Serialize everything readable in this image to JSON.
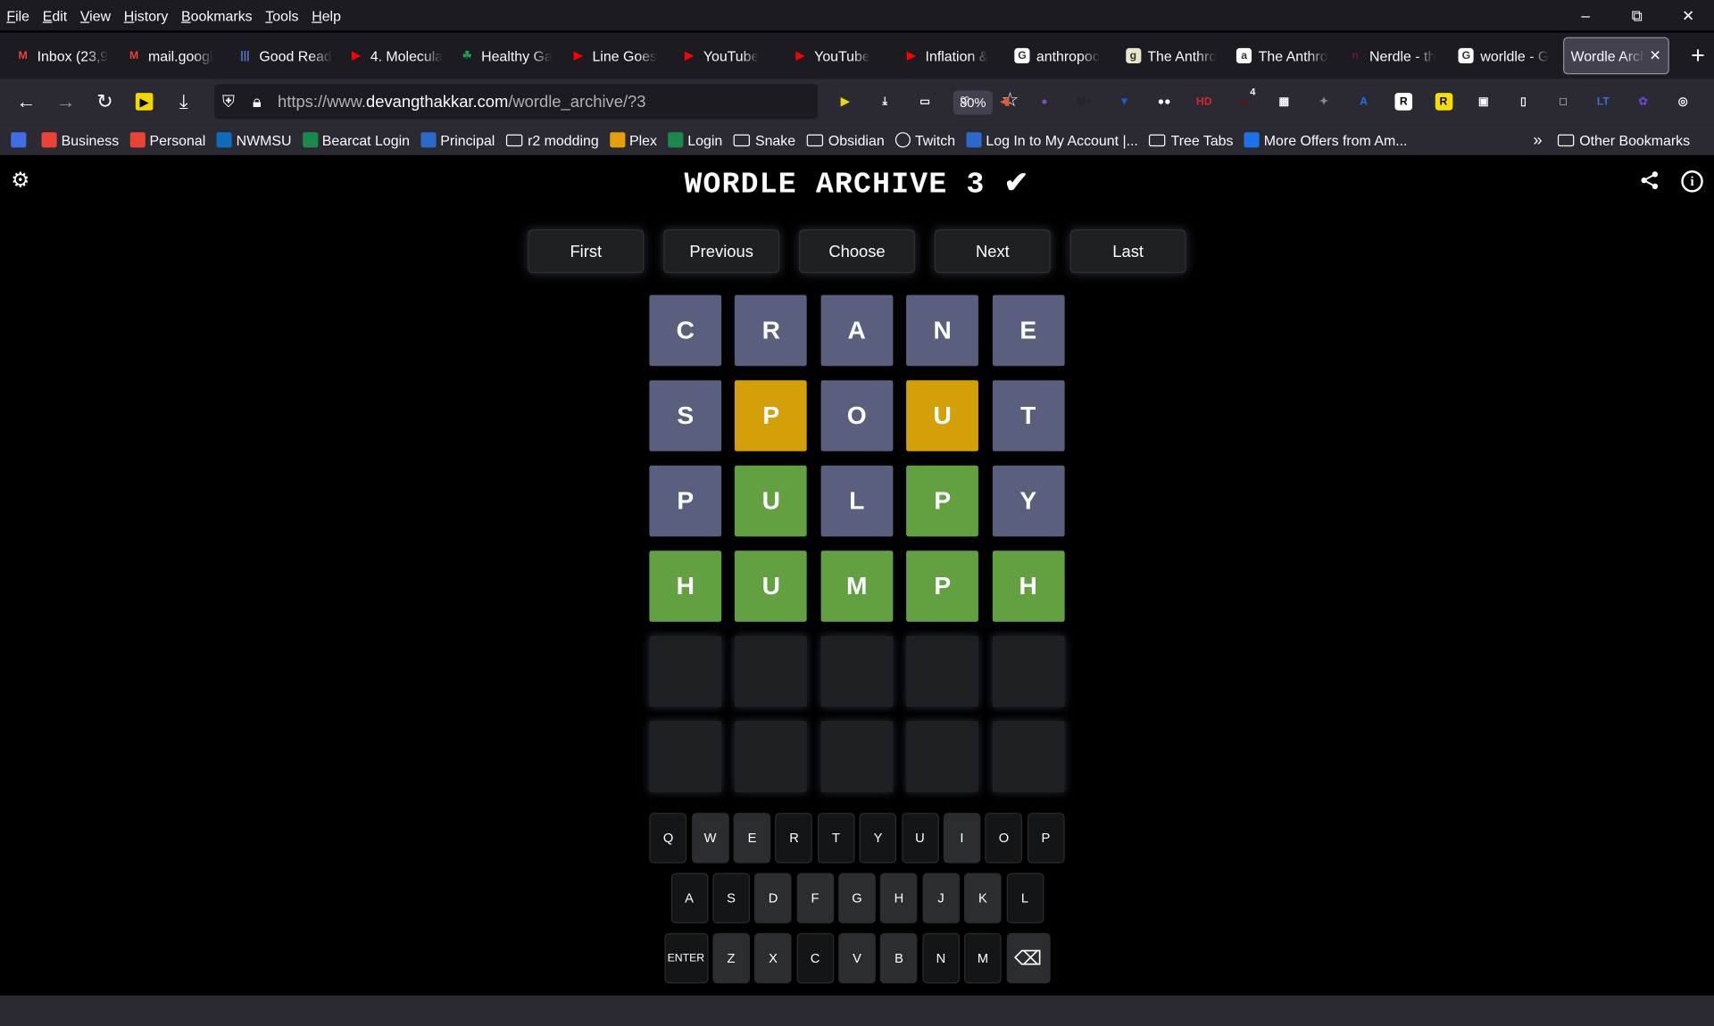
{
  "menu": [
    "File",
    "Edit",
    "View",
    "History",
    "Bookmarks",
    "Tools",
    "Help"
  ],
  "window_controls": {
    "minimize": "–",
    "restore": "⧉",
    "close": "✕"
  },
  "tabs": [
    {
      "label": "Inbox (23,9",
      "icon": "gmail-icon",
      "color": "#ea4335",
      "glyph": "M"
    },
    {
      "label": "mail.googl",
      "icon": "gmail-icon",
      "color": "#ea4335",
      "glyph": "M"
    },
    {
      "label": "Good Read",
      "icon": "library-icon",
      "color": "#4f7bd9",
      "glyph": "|||"
    },
    {
      "label": "4. Molecula",
      "icon": "youtube-icon",
      "color": "#ff0000",
      "glyph": "▶"
    },
    {
      "label": "Healthy Ga",
      "icon": "clover-icon",
      "color": "#1aa34a",
      "glyph": "☘"
    },
    {
      "label": "Line Goes",
      "icon": "youtube-icon",
      "color": "#ff0000",
      "glyph": "▶"
    },
    {
      "label": "YouTube",
      "icon": "youtube-icon",
      "color": "#ff0000",
      "glyph": "▶"
    },
    {
      "label": "YouTube",
      "icon": "youtube-icon",
      "color": "#ff0000",
      "glyph": "▶"
    },
    {
      "label": "Inflation &",
      "icon": "youtube-icon",
      "color": "#ff0000",
      "glyph": "▶"
    },
    {
      "label": "anthropoc",
      "icon": "google-icon",
      "color": "#ffffff",
      "glyph": "G"
    },
    {
      "label": "The Anthro",
      "icon": "goodreads-icon",
      "color": "#e9e5cd",
      "glyph": "g"
    },
    {
      "label": "The Anthro",
      "icon": "amazon-icon",
      "color": "#ffffff",
      "glyph": "a"
    },
    {
      "label": "Nerdle - th",
      "icon": "nerdle-icon",
      "color": "#820458",
      "glyph": "n"
    },
    {
      "label": "worldle - G",
      "icon": "google-icon",
      "color": "#ffffff",
      "glyph": "G"
    },
    {
      "label": "Wordle Arch",
      "icon": "none",
      "color": "",
      "glyph": "",
      "active": true
    }
  ],
  "tab_close": "✕",
  "new_tab": "+",
  "url": {
    "prefix": "https://www.",
    "domain": "devangthakkar.com",
    "path": "/wordle_archive/?3"
  },
  "zoom": "80%",
  "extensions": [
    {
      "name": "video-speed-icon",
      "color": "#f2d600",
      "glyph": "▶"
    },
    {
      "name": "download-icon",
      "color": "",
      "glyph": "⤓"
    },
    {
      "name": "reader-icon",
      "color": "",
      "glyph": "▭"
    },
    {
      "name": "pocket-icon",
      "color": "",
      "glyph": "♡"
    },
    {
      "name": "megaphone-icon",
      "color": "#e25c2f",
      "glyph": "◀"
    },
    {
      "name": "tor-icon",
      "color": "#7e4bcc",
      "glyph": "●"
    },
    {
      "name": "mplus-icon",
      "color": "#222",
      "glyph": "M+"
    },
    {
      "name": "bitwarden-icon",
      "color": "#175ddc",
      "glyph": "▼"
    },
    {
      "name": "glasses-icon",
      "color": "",
      "glyph": "●●"
    },
    {
      "name": "hd-icon",
      "color": "#d9252a",
      "glyph": "HD"
    },
    {
      "name": "ublock-icon",
      "color": "#800000",
      "glyph": "u"
    },
    {
      "name": "grid-icon",
      "color": "",
      "glyph": "▦"
    },
    {
      "name": "puzzle-icon",
      "color": "#888",
      "glyph": "✦"
    },
    {
      "name": "translate-icon",
      "color": "#1a73e8",
      "glyph": "A"
    },
    {
      "name": "r-icon",
      "color": "#ffffff",
      "glyph": "R"
    },
    {
      "name": "r-yellow-icon",
      "color": "#f5dd0a",
      "glyph": "R"
    },
    {
      "name": "camera-icon",
      "color": "",
      "glyph": "▣"
    },
    {
      "name": "page-icon",
      "color": "",
      "glyph": "▯"
    },
    {
      "name": "chat-icon",
      "color": "",
      "glyph": "□"
    },
    {
      "name": "lt-icon",
      "color": "#3a6fd8",
      "glyph": "LT"
    },
    {
      "name": "feather-icon",
      "color": "#6b3fd0",
      "glyph": "✿"
    },
    {
      "name": "shield-icon",
      "color": "",
      "glyph": "◎"
    },
    {
      "name": "purple-app-icon",
      "color": "#a260e8",
      "glyph": "◆"
    },
    {
      "name": "menu-icon",
      "color": "",
      "glyph": "≡"
    }
  ],
  "ublock_badge": "4",
  "bookmarks": [
    {
      "label": "",
      "icon": "proton-icon",
      "color": "#3d6ee6",
      "type": "icon"
    },
    {
      "label": "Business",
      "icon": "gmail-icon",
      "color": "#ea4335",
      "type": "icon"
    },
    {
      "label": "Personal",
      "icon": "gmail-icon",
      "color": "#ea4335",
      "type": "icon"
    },
    {
      "label": "NWMSU",
      "icon": "outlook-icon",
      "color": "#0f6cbd",
      "type": "icon"
    },
    {
      "label": "Bearcat Login",
      "icon": "n-icon",
      "color": "#1a8a4c",
      "type": "icon"
    },
    {
      "label": "Principal",
      "icon": "principal-icon",
      "color": "#2a6ac8",
      "type": "icon"
    },
    {
      "label": "r2 modding",
      "icon": "folder-icon",
      "color": "",
      "type": "folder"
    },
    {
      "label": "Plex",
      "icon": "plex-icon",
      "color": "#e5a00d",
      "type": "icon"
    },
    {
      "label": "Login",
      "icon": "n-icon",
      "color": "#1a8a4c",
      "type": "icon"
    },
    {
      "label": "Snake",
      "icon": "folder-icon",
      "color": "",
      "type": "folder"
    },
    {
      "label": "Obsidian",
      "icon": "folder-icon",
      "color": "",
      "type": "folder"
    },
    {
      "label": "Twitch",
      "icon": "globe-icon",
      "color": "",
      "type": "icon"
    },
    {
      "label": "Log In to My Account |...",
      "icon": "account-icon",
      "color": "#2a6ac8",
      "type": "icon"
    },
    {
      "label": "Tree Tabs",
      "icon": "folder-icon",
      "color": "",
      "type": "folder"
    },
    {
      "label": "More Offers from Am...",
      "icon": "offers-icon",
      "color": "#1a73e8",
      "type": "icon"
    }
  ],
  "other_bookmarks": "Other Bookmarks",
  "page": {
    "title": "WORDLE ARCHIVE 3 ✔",
    "nav_buttons": [
      "First",
      "Previous",
      "Choose",
      "Next",
      "Last"
    ]
  },
  "colors": {
    "absent": "#5b5f7e",
    "present": "#d4a00a",
    "correct": "#63a042"
  },
  "board": [
    [
      {
        "l": "C",
        "s": "gray"
      },
      {
        "l": "R",
        "s": "gray"
      },
      {
        "l": "A",
        "s": "gray"
      },
      {
        "l": "N",
        "s": "gray"
      },
      {
        "l": "E",
        "s": "gray"
      }
    ],
    [
      {
        "l": "S",
        "s": "gray"
      },
      {
        "l": "P",
        "s": "yellow"
      },
      {
        "l": "O",
        "s": "gray"
      },
      {
        "l": "U",
        "s": "yellow"
      },
      {
        "l": "T",
        "s": "gray"
      }
    ],
    [
      {
        "l": "P",
        "s": "gray"
      },
      {
        "l": "U",
        "s": "green"
      },
      {
        "l": "L",
        "s": "gray"
      },
      {
        "l": "P",
        "s": "green"
      },
      {
        "l": "Y",
        "s": "gray"
      }
    ],
    [
      {
        "l": "H",
        "s": "green"
      },
      {
        "l": "U",
        "s": "green"
      },
      {
        "l": "M",
        "s": "green"
      },
      {
        "l": "P",
        "s": "green"
      },
      {
        "l": "H",
        "s": "green"
      }
    ],
    [
      {
        "l": "",
        "s": "empty"
      },
      {
        "l": "",
        "s": "empty"
      },
      {
        "l": "",
        "s": "empty"
      },
      {
        "l": "",
        "s": "empty"
      },
      {
        "l": "",
        "s": "empty"
      }
    ],
    [
      {
        "l": "",
        "s": "empty"
      },
      {
        "l": "",
        "s": "empty"
      },
      {
        "l": "",
        "s": "empty"
      },
      {
        "l": "",
        "s": "empty"
      },
      {
        "l": "",
        "s": "empty"
      }
    ]
  ],
  "keyboard": [
    [
      {
        "k": "Q"
      },
      {
        "k": "W",
        "used": true
      },
      {
        "k": "E",
        "used": true
      },
      {
        "k": "R"
      },
      {
        "k": "T"
      },
      {
        "k": "Y"
      },
      {
        "k": "U"
      },
      {
        "k": "I",
        "used": true
      },
      {
        "k": "O"
      },
      {
        "k": "P"
      }
    ],
    [
      {
        "k": "A"
      },
      {
        "k": "S"
      },
      {
        "k": "D",
        "used": true
      },
      {
        "k": "F",
        "used": true
      },
      {
        "k": "G",
        "used": true
      },
      {
        "k": "H",
        "used": true
      },
      {
        "k": "J",
        "used": true
      },
      {
        "k": "K",
        "used": true
      },
      {
        "k": "L"
      }
    ],
    [
      {
        "k": "ENTER",
        "wide": true
      },
      {
        "k": "Z",
        "used": true
      },
      {
        "k": "X",
        "used": true
      },
      {
        "k": "C"
      },
      {
        "k": "V",
        "used": true
      },
      {
        "k": "B",
        "used": true
      },
      {
        "k": "N"
      },
      {
        "k": "M"
      },
      {
        "k": "⌫",
        "wide": true,
        "used": true,
        "name": "backspace-key"
      }
    ]
  ]
}
